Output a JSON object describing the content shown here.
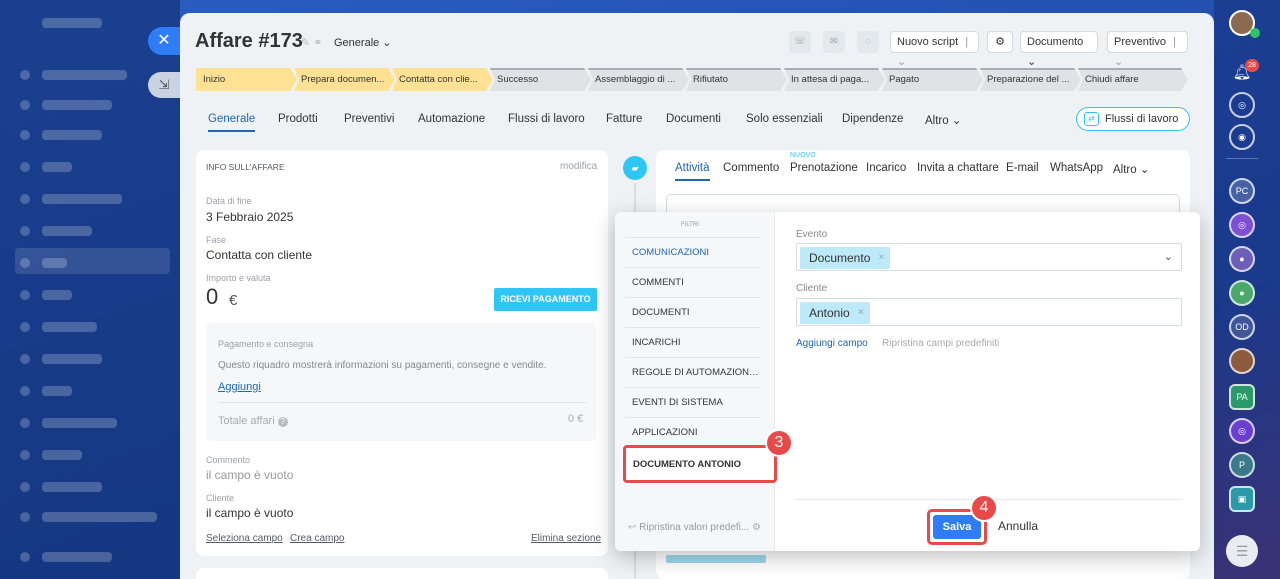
{
  "deal": {
    "title": "Affare #173",
    "category": "Generale ⌄"
  },
  "header": {
    "script_btn": "Nuovo script",
    "documento_btn": "Documento ⌄",
    "preventivo_btn": "Preventivo"
  },
  "stages": [
    "Inizio",
    "Prepara documen...",
    "Contatta con clie...",
    "Successo",
    "Assemblaggio di ...",
    "Rifiutato",
    "In attesa di paga...",
    "Pagato",
    "Preparazione del ...",
    "Chiudi affare"
  ],
  "tabs": [
    "Generale",
    "Prodotti",
    "Preventivi",
    "Automazione",
    "Flussi di lavoro",
    "Fatture",
    "Documenti",
    "Solo essenziali",
    "Dipendenze",
    "Altro ⌄"
  ],
  "flussi_btn": "Flussi di lavoro",
  "info": {
    "header": "INFO SULL'AFFARE",
    "edit": "modifica",
    "end_date_label": "Data di fine",
    "end_date": "3 Febbraio 2025",
    "stage_label": "Fase",
    "stage": "Contatta con cliente",
    "amount_label": "Importo e valuta",
    "amount": "0",
    "currency": "€",
    "pay_btn": "RICEVI PAGAMENTO",
    "pay_title": "Pagamento e consegna",
    "pay_desc": "Questo riquadro mostrerà informazioni su pagamenti, consegne e vendite.",
    "pay_add": "Aggiungi",
    "total_label": "Totale affari",
    "total_value": "0 €",
    "comment_label": "Commento",
    "comment_value": "il campo è vuoto",
    "client_label": "Cliente",
    "client_value": "il campo è vuoto",
    "select_field": "Seleziona campo",
    "create_field": "Crea campo",
    "delete_section": "Elimina sezione"
  },
  "activity_tabs": [
    "Attività",
    "Commento",
    "Prenotazione",
    "Incarico",
    "Invita a chattare",
    "E-mail",
    "WhatsApp",
    "Altro ⌄"
  ],
  "activity_new": "NUOVO",
  "filter": {
    "title": "FILTRI",
    "items": [
      "COMUNICAZIONI",
      "COMMENTI",
      "DOCUMENTI",
      "INCARICHI",
      "REGOLE DI AUTOMAZIONE E...",
      "EVENTI DI SISTEMA",
      "APPLICAZIONI"
    ],
    "saved_preset": "DOCUMENTO ANTONIO",
    "reset_defaults": "Ripristina valori predefi...",
    "event_label": "Evento",
    "event_value": "Documento",
    "client_label": "Cliente",
    "client_value": "Antonio",
    "add_field": "Aggiungi campo",
    "reset_fields": "Ripristina campi predefiniti",
    "save": "Salva",
    "cancel": "Annulla"
  },
  "badges": {
    "step3": "3",
    "step4": "4"
  },
  "notifications_count": "28",
  "right_bar": [
    "PC",
    "OD",
    "PA",
    "P"
  ]
}
